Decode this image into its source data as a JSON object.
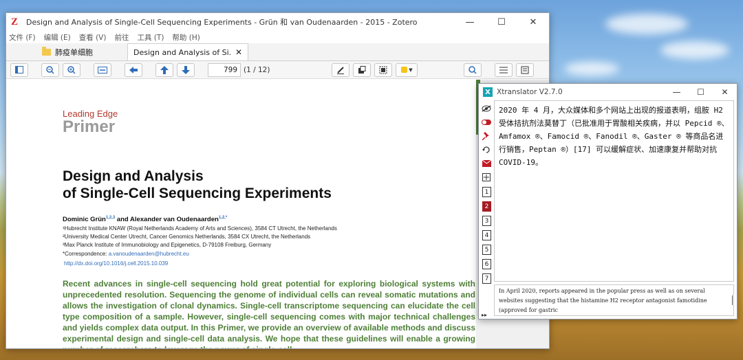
{
  "zotero": {
    "title": "Design and Analysis of Single-Cell Sequencing Experiments - Grün 和 van Oudenaarden - 2015 - Zotero",
    "logo": "Z",
    "menu": [
      "文件 (F)",
      "编辑 (E)",
      "查看 (V)",
      "前往",
      "工具 (T)",
      "帮助 (H)"
    ],
    "tabs": [
      {
        "label": "肺疫单细胞",
        "icon": "folder-icon"
      },
      {
        "label": "Design and Analysis of Si...",
        "icon": ""
      }
    ],
    "tab_close": "✕",
    "page_input": "799",
    "page_count": "(1 / 12)",
    "window_controls": [
      "—",
      "☐",
      "✕"
    ],
    "highlight_color": "#f5c518"
  },
  "paper": {
    "section_label": "Leading Edge",
    "section_title": "Primer",
    "title_line1": "Design and Analysis",
    "title_line2": "of Single-Cell Sequencing Experiments",
    "author1": "Dominic Grün",
    "author1_sup": "1,2,3",
    "author_and": " and Alexander van Oudenaarden",
    "author2_sup": "1,2,*",
    "affil1": "¹Hubrecht Institute KNAW (Royal Netherlands Academy of Arts and Sciences), 3584 CT Utrecht, the Netherlands",
    "affil2": "²University Medical Center Utrecht, Cancer Genomics Netherlands, 3584 CX Utrecht, the Netherlands",
    "affil3": "³Max Planck Institute of Immunobiology and Epigenetics, D-79108 Freiburg, Germany",
    "correspondence_label": "*Correspondence: ",
    "correspondence_email": "a.vanoudenaarden@hubrecht.eu",
    "doi": "http://dx.doi.org/10.1016/j.cell.2015.10.039",
    "abstract": "Recent advances in single-cell sequencing hold great potential for exploring biological systems with unprecedented resolution. Sequencing the genome of individual cells can reveal somatic mutations and allows the investigation of clonal dynamics. Single-cell transcriptome sequencing can elucidate the cell type composition of a sample. However, single-cell sequencing comes with major technical challenges and yields complex data output. In this Primer, we provide an overview of available methods and discuss experimental design and single-cell data analysis. We hope that these guidelines will enable a growing number of researchers to leverage the power of single-cell"
  },
  "xtranslator": {
    "title": "Xtranslator V2.7.0",
    "logo": "X",
    "window_controls": [
      "—",
      "☐",
      "✕"
    ],
    "tabs": [
      "1",
      "2",
      "3",
      "4",
      "5",
      "6",
      "7"
    ],
    "active_tab": "2",
    "output": "2020 年 4 月，大众媒体和多个网站上出现的报道表明，组胺 H2 受体拮抗剂法莫替丁（已批准用于胃酸相关疾病，并以 Pepcid ®、Amfamox ®、Famocid ®、Fanodil ®、Gaster ® 等商品名进行销售，Peptan ®）[17] 可以缓解症状、加速康复并帮助对抗 COVID-19。",
    "input": "In April 2020, reports appeared in the popular press as well as on several websites suggesting that the histamine H2 receptor antagonist famotidine (approved for gastric"
  }
}
